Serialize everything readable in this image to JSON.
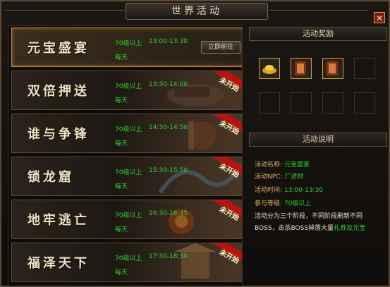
{
  "window": {
    "title": "世界活动",
    "close_label": "✕"
  },
  "activities": [
    {
      "name": "元宝盛宴",
      "level": "70级以上",
      "time": "13:00-13:30",
      "frequency": "每天",
      "status": "立即前往",
      "selected": true
    },
    {
      "name": "双倍押送",
      "level": "70级以上",
      "time": "13:30-14:00",
      "frequency": "每天",
      "status": "未开始"
    },
    {
      "name": "谁与争锋",
      "level": "70级以上",
      "time": "14:30-14:50",
      "frequency": "每天",
      "status": "未开始"
    },
    {
      "name": "锁龙窟",
      "level": "70级以上",
      "time": "15:30-15:50",
      "frequency": "每天",
      "status": "未开始"
    },
    {
      "name": "地牢逃亡",
      "level": "70级以上",
      "time": "16:30-16:45",
      "frequency": "每天",
      "status": "未开始"
    },
    {
      "name": "福泽天下",
      "level": "70级以上",
      "time": "17:30-18:30",
      "frequency": "每天",
      "status": "未开始"
    }
  ],
  "rewards": {
    "header": "活动奖励",
    "items": [
      {
        "icon": "gold-ingot-icon"
      },
      {
        "icon": "skill-book-icon"
      },
      {
        "icon": "skill-book-icon"
      }
    ]
  },
  "description": {
    "header": "活动说明",
    "name_label": "活动名称:",
    "name_value": "元宝盛宴",
    "npc_label": "活动NPC:",
    "npc_value": "广进财",
    "time_label": "活动时间:",
    "time_value": "13:00-13:30",
    "level_label": "参与等级:",
    "level_value": "70级以上",
    "text1": "活动分为三个阶段，不同阶段刷新不同",
    "text2_a": "BOSS，击杀BOSS掉落大量",
    "text2_b": "礼券及元宝"
  },
  "colors": {
    "accent": "#c88a3c",
    "green_text": "#2fd02f",
    "ribbon_red": "#b8140e"
  }
}
